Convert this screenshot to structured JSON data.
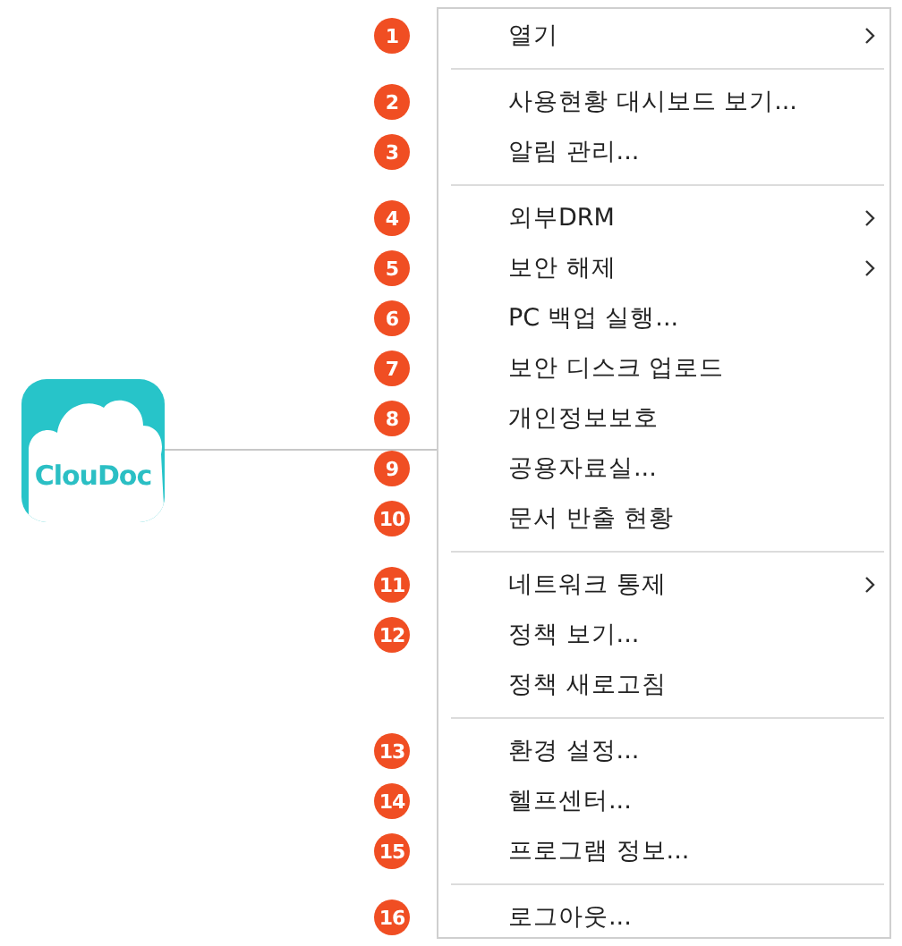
{
  "logo": {
    "text": "ClouDoc"
  },
  "menu": [
    {
      "kind": "item",
      "badge": "1",
      "label": "열기",
      "submenu": true
    },
    {
      "kind": "separator"
    },
    {
      "kind": "item",
      "badge": "2",
      "label": "사용현황 대시보드 보기...",
      "submenu": false
    },
    {
      "kind": "item",
      "badge": "3",
      "label": "알림 관리...",
      "submenu": false
    },
    {
      "kind": "separator"
    },
    {
      "kind": "item",
      "badge": "4",
      "label": "외부DRM",
      "submenu": true
    },
    {
      "kind": "item",
      "badge": "5",
      "label": "보안 해제",
      "submenu": true
    },
    {
      "kind": "item",
      "badge": "6",
      "label": "PC 백업 실행...",
      "submenu": false
    },
    {
      "kind": "item",
      "badge": "7",
      "label": "보안 디스크 업로드",
      "submenu": false
    },
    {
      "kind": "item",
      "badge": "8",
      "label": "개인정보보호",
      "submenu": false
    },
    {
      "kind": "item",
      "badge": "9",
      "label": "공용자료실...",
      "submenu": false
    },
    {
      "kind": "item",
      "badge": "10",
      "label": "문서 반출 현황",
      "submenu": false
    },
    {
      "kind": "separator"
    },
    {
      "kind": "item",
      "badge": "11",
      "label": "네트워크 통제",
      "submenu": true
    },
    {
      "kind": "item",
      "badge": "12",
      "label": "정책 보기...",
      "submenu": false
    },
    {
      "kind": "item",
      "label": "정책 새로고침",
      "submenu": false
    },
    {
      "kind": "separator"
    },
    {
      "kind": "item",
      "badge": "13",
      "label": "환경 설정...",
      "submenu": false
    },
    {
      "kind": "item",
      "badge": "14",
      "label": "헬프센터...",
      "submenu": false
    },
    {
      "kind": "item",
      "badge": "15",
      "label": "프로그램 정보...",
      "submenu": false
    },
    {
      "kind": "separator"
    },
    {
      "kind": "item",
      "badge": "16",
      "label": "로그아웃...",
      "submenu": false
    }
  ]
}
